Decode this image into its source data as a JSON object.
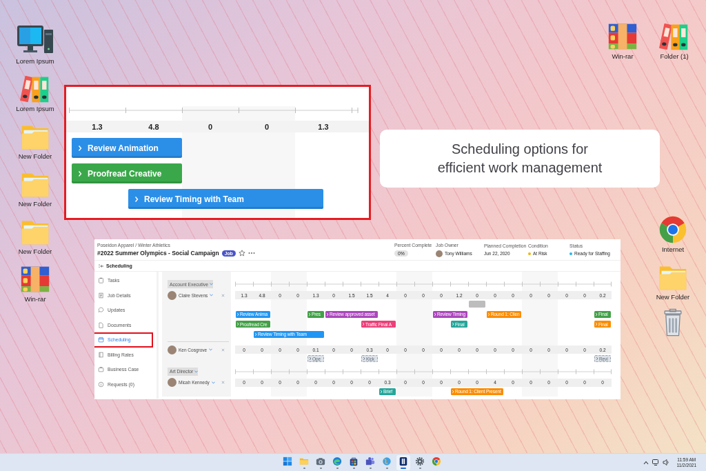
{
  "desktop": {
    "left_icons": [
      {
        "kind": "computer",
        "label": "Lorem Ipsum"
      },
      {
        "kind": "binders",
        "label": "Lorem Ipsum"
      },
      {
        "kind": "folder",
        "label": "New Folder"
      },
      {
        "kind": "folder",
        "label": "New Folder"
      },
      {
        "kind": "folder",
        "label": "New Folder"
      },
      {
        "kind": "archive",
        "label": "Win-rar"
      }
    ],
    "top_right_icons": [
      {
        "kind": "archive",
        "label": "Win-rar"
      },
      {
        "kind": "binders",
        "label": "Folder (1)"
      }
    ],
    "right_icons": [
      {
        "kind": "browser",
        "label": "Internet"
      },
      {
        "kind": "folder",
        "label": "New Folder"
      },
      {
        "kind": "trash"
      }
    ]
  },
  "zoom_inset": {
    "hours": [
      "1.3",
      "4.8",
      "0",
      "0",
      "1.3"
    ],
    "lanes": [
      [
        {
          "kind": "task",
          "label": "Review Animation",
          "color": "#2b8fe8"
        }
      ],
      [
        {
          "kind": "task",
          "label": "Proofread Creative",
          "color": "#3aa84a"
        }
      ],
      [
        {
          "kind": "task",
          "label": "Review Timing with Team",
          "color": "#2b8fe8"
        }
      ]
    ]
  },
  "callout": {
    "text": "Scheduling options for efficient work management"
  },
  "app": {
    "breadcrumb": "Poseidon Apparel / Winter Athletics",
    "title": "#2022 Summer Olympics - Social Campaign",
    "badge": "Job",
    "fields": [
      {
        "kind": "pill",
        "label": "Percent Complete",
        "value": "0%"
      },
      {
        "kind": "person",
        "label": "Job Owner",
        "value": "Tony Williams"
      },
      {
        "kind": "text",
        "label": "Planned Completion",
        "value": "Jun 22, 2020"
      },
      {
        "kind": "dot",
        "label": "Condition",
        "value": "At Risk",
        "color": "#f5b400"
      },
      {
        "kind": "dot",
        "label": "Status",
        "value": "Ready for Staffing",
        "color": "#22b8f0"
      }
    ],
    "page_title": "Scheduling",
    "sidebar": [
      {
        "label": "Tasks",
        "selected": false
      },
      {
        "label": "Job Details",
        "selected": false
      },
      {
        "label": "Updates",
        "selected": false
      },
      {
        "label": "Documents",
        "selected": false
      },
      {
        "label": "Scheduling",
        "selected": true
      },
      {
        "label": "Billing Rates",
        "selected": false
      },
      {
        "label": "Business Case",
        "selected": false
      },
      {
        "label": "Requests (0)",
        "selected": false
      }
    ],
    "sections": [
      {
        "role": "Account Executive",
        "people": [
          {
            "name": "Claire Stevens",
            "hours": [
              "1.3",
              "4.8",
              "0",
              "0",
              "1.3",
              "0",
              "1.5",
              "1.5",
              "4",
              "0",
              "0",
              "0",
              "1.2",
              "0",
              "0",
              "0",
              "0",
              "0",
              "0",
              "0",
              "0.2"
            ],
            "lanes": [
              [
                {
                  "kind": "block"
                }
              ],
              [
                {
                  "kind": "task",
                  "label": "Review Anima",
                  "color": "#2196f3"
                },
                {
                  "kind": "task",
                  "label": "Pres",
                  "color": "#43a047"
                },
                {
                  "kind": "task",
                  "label": "Review approved asset",
                  "color": "#ab47bc"
                },
                {
                  "kind": "task",
                  "label": "Review Timing",
                  "color": "#ab47bc"
                },
                {
                  "kind": "task",
                  "label": "Round 1: Clien",
                  "color": "#fb8c00"
                },
                {
                  "kind": "task",
                  "label": "Final",
                  "color": "#43a047"
                }
              ],
              [
                {
                  "kind": "task",
                  "label": "Proofread Cre",
                  "color": "#43a047"
                },
                {
                  "kind": "task",
                  "label": "Traffic Final A",
                  "color": "#ec407a"
                },
                {
                  "kind": "task",
                  "label": "Final",
                  "color": "#26a69a"
                },
                {
                  "kind": "task",
                  "label": "Final",
                  "color": "#fb8c00"
                }
              ],
              [
                {
                  "kind": "task",
                  "label": "Review Timing with Team",
                  "color": "#2196f3"
                }
              ]
            ]
          },
          {
            "name": "Ken Cosgrove",
            "hours": [
              "0",
              "0",
              "0",
              "0",
              "0.1",
              "0",
              "0",
              "0.3",
              "0",
              "0",
              "0",
              "0",
              "0",
              "0",
              "0",
              "0",
              "0",
              "0",
              "0",
              "0",
              "0.2"
            ],
            "lanes": [
              [
                {
                  "kind": "placeholder",
                  "label": "Ope"
                },
                {
                  "kind": "placeholder",
                  "label": "Kick"
                },
                {
                  "kind": "placeholder",
                  "label": "Revi"
                }
              ]
            ]
          }
        ]
      },
      {
        "role": "Art Director",
        "people": [
          {
            "name": "Micah Kennedy",
            "hours": [
              "0",
              "0",
              "0",
              "0",
              "0",
              "0",
              "0",
              "0",
              "0.3",
              "0",
              "0",
              "0",
              "0",
              "0",
              "4",
              "0",
              "0",
              "0",
              "0",
              "0",
              "0"
            ],
            "lanes": [
              [
                {
                  "kind": "task",
                  "label": "Brief",
                  "color": "#26a69a"
                },
                {
                  "kind": "task",
                  "label": "Round 1: Client Present",
                  "color": "#fb8c00"
                }
              ]
            ]
          }
        ]
      }
    ]
  },
  "taskbar": {
    "apps": [
      {
        "kind": "start",
        "running": false,
        "active": false
      },
      {
        "kind": "folder",
        "running": true,
        "active": false
      },
      {
        "kind": "camera",
        "running": true,
        "active": false
      },
      {
        "kind": "swirl",
        "running": true,
        "active": false
      },
      {
        "kind": "bag",
        "running": true,
        "active": false
      },
      {
        "kind": "people",
        "running": true,
        "active": false
      },
      {
        "kind": "globe",
        "running": true,
        "active": false
      },
      {
        "kind": "app",
        "running": true,
        "active": true
      },
      {
        "kind": "gear",
        "running": true,
        "active": false
      },
      {
        "kind": "browser",
        "running": false,
        "active": false
      }
    ],
    "time": "11:59 AM",
    "date": "11/2/2021"
  }
}
